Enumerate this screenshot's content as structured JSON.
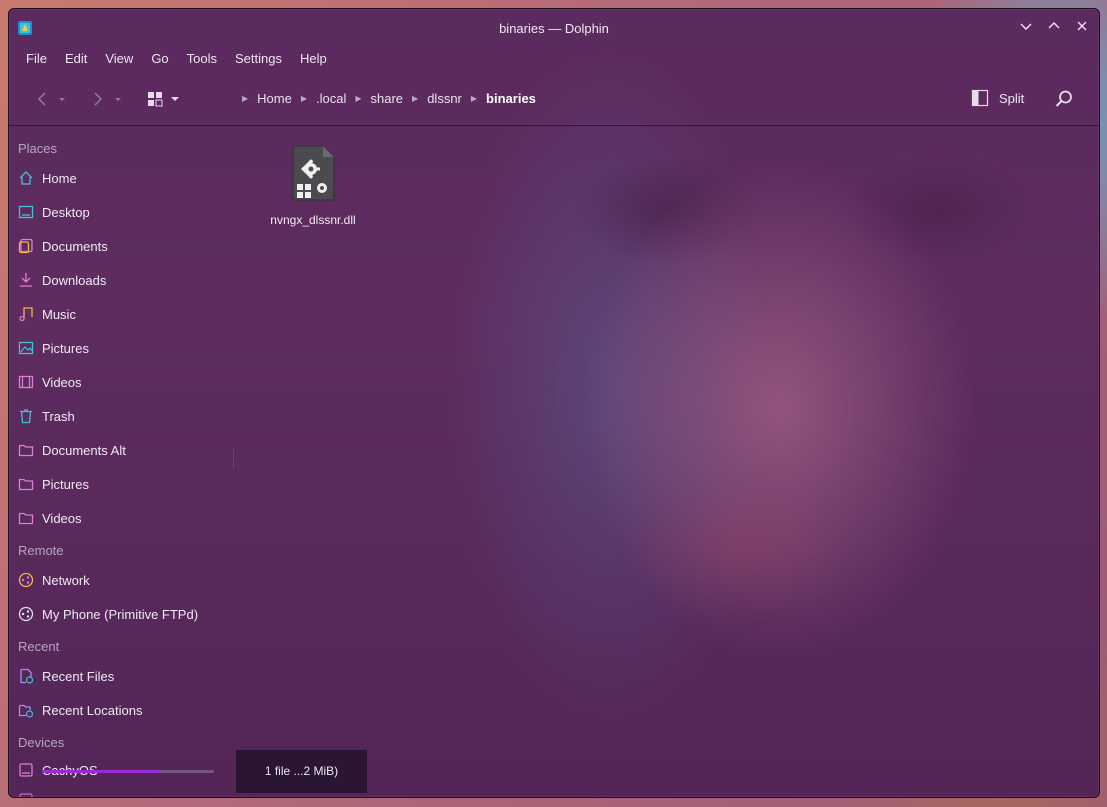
{
  "window": {
    "title": "binaries — Dolphin"
  },
  "menu": [
    "File",
    "Edit",
    "View",
    "Go",
    "Tools",
    "Settings",
    "Help"
  ],
  "breadcrumb": [
    "Home",
    ".local",
    "share",
    "dlssnr",
    "binaries"
  ],
  "toolbar": {
    "split_label": "Split"
  },
  "sidebar": {
    "places_header": "Places",
    "places": [
      {
        "label": "Home",
        "icon": "home-icon"
      },
      {
        "label": "Desktop",
        "icon": "desktop-icon"
      },
      {
        "label": "Documents",
        "icon": "documents-icon"
      },
      {
        "label": "Downloads",
        "icon": "downloads-icon"
      },
      {
        "label": "Music",
        "icon": "music-icon"
      },
      {
        "label": "Pictures",
        "icon": "pictures-icon"
      },
      {
        "label": "Videos",
        "icon": "videos-icon"
      },
      {
        "label": "Trash",
        "icon": "trash-icon"
      },
      {
        "label": "Documents Alt",
        "icon": "folder-icon"
      },
      {
        "label": "Pictures",
        "icon": "folder-icon"
      },
      {
        "label": "Videos",
        "icon": "folder-icon"
      }
    ],
    "remote_header": "Remote",
    "remote": [
      {
        "label": "Network",
        "icon": "network-icon"
      },
      {
        "label": "My Phone (Primitive FTPd)",
        "icon": "network-icon"
      }
    ],
    "recent_header": "Recent",
    "recent": [
      {
        "label": "Recent Files",
        "icon": "recent-files-icon"
      },
      {
        "label": "Recent Locations",
        "icon": "recent-locations-icon"
      }
    ],
    "devices_header": "Devices",
    "devices": [
      {
        "label": "CachyOS",
        "icon": "drive-icon",
        "usage": 0.68
      }
    ]
  },
  "files": [
    {
      "name": "nvngx_dlssnr.dll",
      "icon": "dll-file-icon"
    }
  ],
  "status": {
    "text": "1 file ...2 MiB)"
  },
  "colors": {
    "accent": "#9b2bd6",
    "icon_teal": "#3fc1d8",
    "icon_pink": "#e07bd6"
  }
}
